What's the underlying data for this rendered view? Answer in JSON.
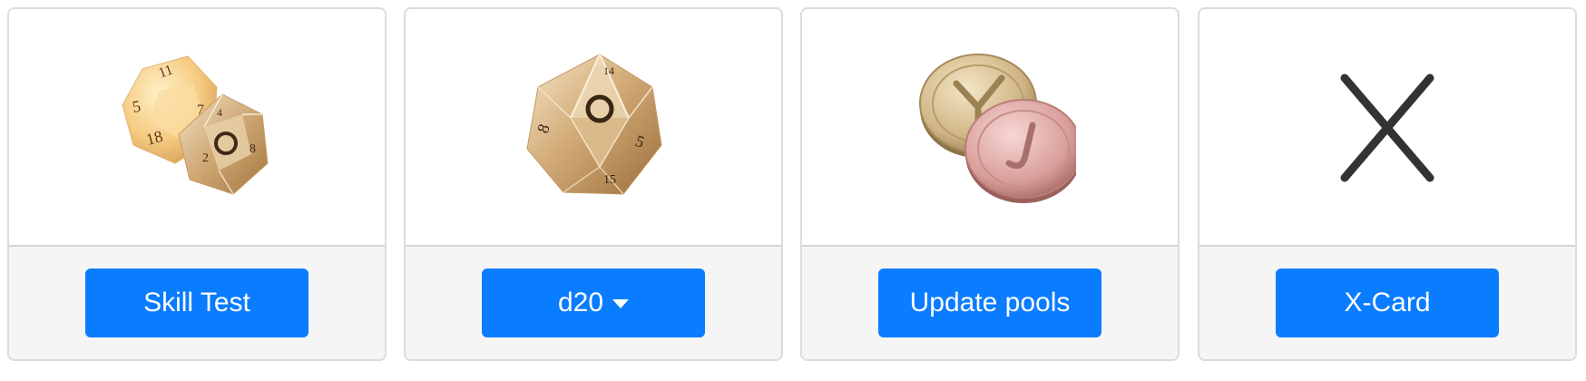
{
  "cards": [
    {
      "button_label": "Skill Test",
      "icon": "dice-pair-icon"
    },
    {
      "button_label": "d20",
      "icon": "d20-die-icon",
      "has_dropdown": true
    },
    {
      "button_label": "Update pools",
      "icon": "coins-icon"
    },
    {
      "button_label": "X-Card",
      "icon": "x-card-icon"
    }
  ],
  "colors": {
    "button": "#0a7cff",
    "footer": "#f5f5f5",
    "border": "#dcdcdc"
  }
}
